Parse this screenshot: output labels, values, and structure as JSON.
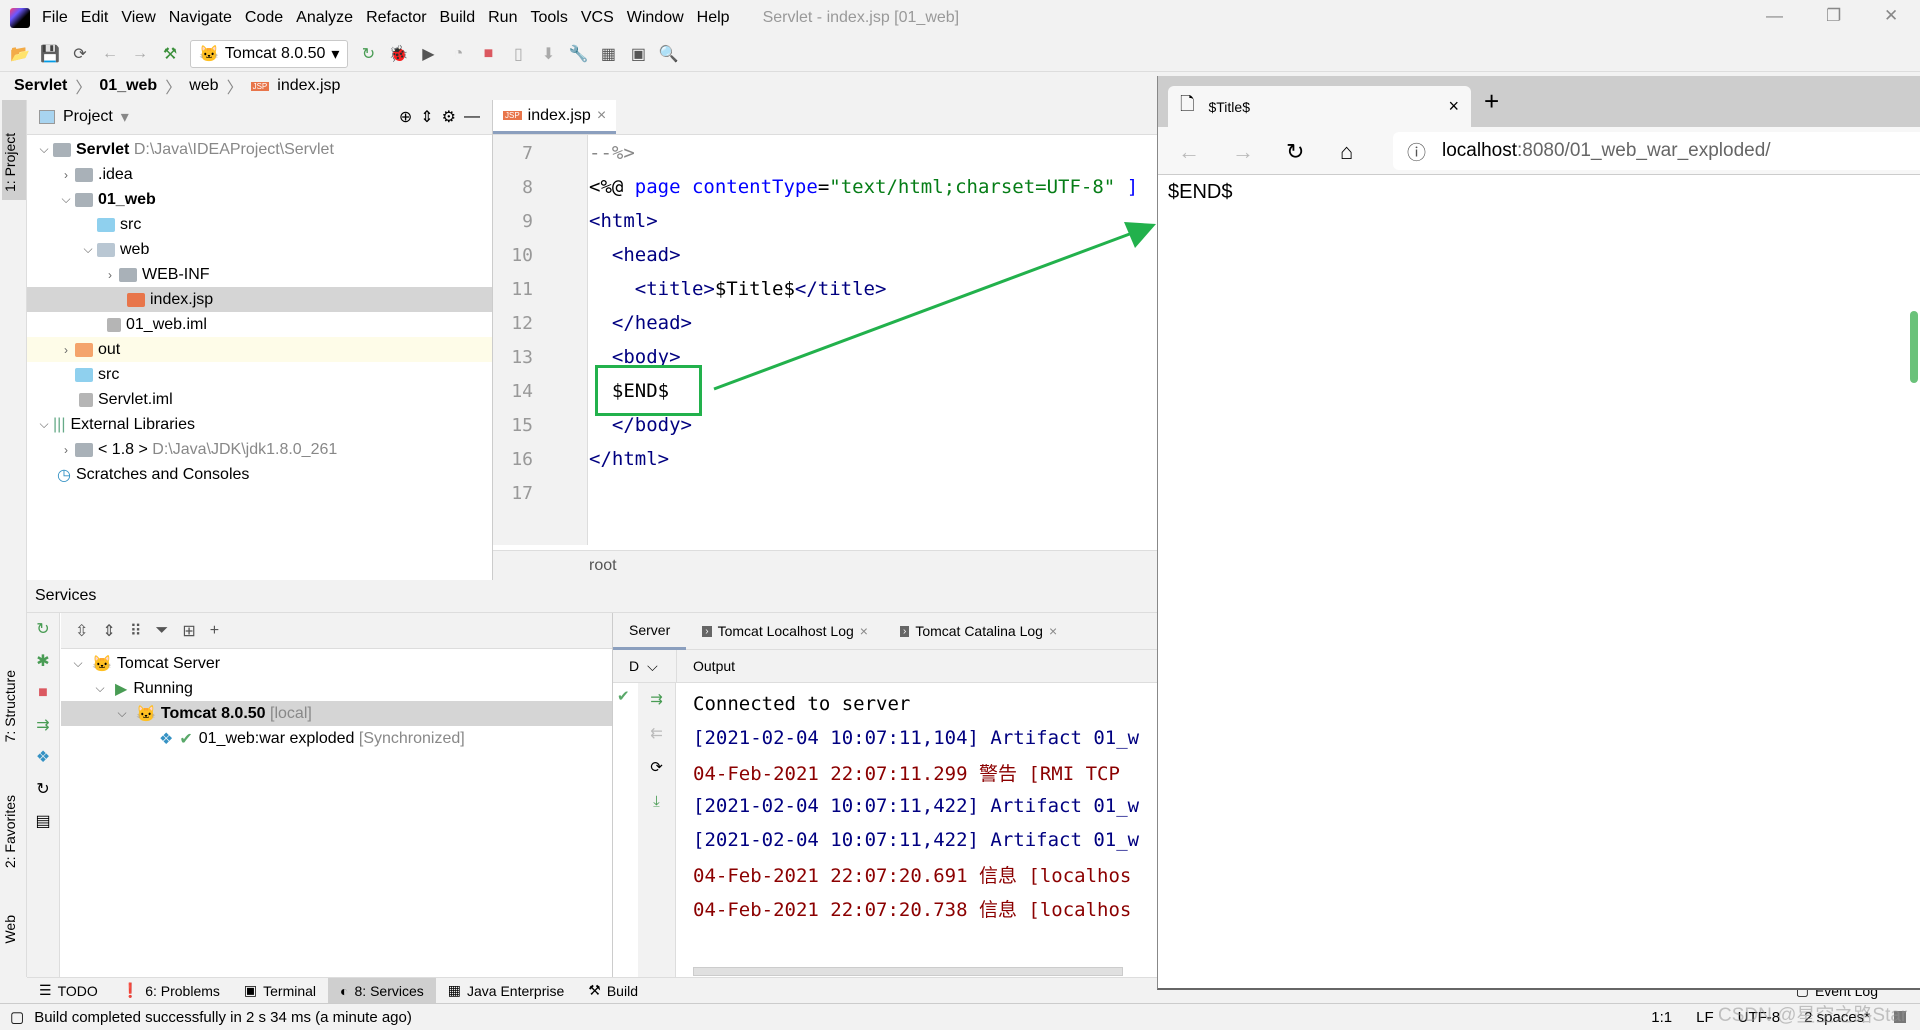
{
  "menubar": {
    "items": [
      "File",
      "Edit",
      "View",
      "Navigate",
      "Code",
      "Analyze",
      "Refactor",
      "Build",
      "Run",
      "Tools",
      "VCS",
      "Window",
      "Help"
    ],
    "title": "Servlet - index.jsp [01_web]"
  },
  "toolbar": {
    "run_config": "Tomcat 8.0.50"
  },
  "breadcrumb": [
    "Servlet",
    "01_web",
    "web",
    "index.jsp"
  ],
  "stripe": {
    "project": "1: Project",
    "structure": "7: Structure",
    "favorites": "2: Favorites",
    "web": "Web"
  },
  "project": {
    "title": "Project",
    "tree": [
      {
        "label": "Servlet",
        "hint": "D:\\Java\\IDEAProject\\Servlet"
      },
      {
        "label": ".idea"
      },
      {
        "label": "01_web"
      },
      {
        "label": "src"
      },
      {
        "label": "web"
      },
      {
        "label": "WEB-INF"
      },
      {
        "label": "index.jsp"
      },
      {
        "label": "01_web.iml"
      },
      {
        "label": "out"
      },
      {
        "label": "src"
      },
      {
        "label": "Servlet.iml"
      },
      {
        "label": "External Libraries"
      },
      {
        "label": "< 1.8 >",
        "hint": "D:\\Java\\JDK\\jdk1.8.0_261"
      },
      {
        "label": "Scratches and Consoles"
      }
    ]
  },
  "editor": {
    "tab": "index.jsp",
    "footer": "root",
    "lines": [
      {
        "n": "7",
        "parts": [
          [
            "--%>",
            "gray"
          ]
        ]
      },
      {
        "n": "8",
        "parts": [
          [
            "<%@ ",
            ""
          ],
          [
            "page ",
            "attr"
          ],
          [
            "contentType",
            "attr"
          ],
          [
            "=",
            ""
          ],
          [
            "\"text/html;charset=UTF-8\"",
            "str"
          ],
          [
            " ]",
            "attr"
          ]
        ]
      },
      {
        "n": "9",
        "parts": [
          [
            "<html>",
            "tag"
          ]
        ]
      },
      {
        "n": "10",
        "parts": [
          [
            "  <head>",
            "tag"
          ]
        ]
      },
      {
        "n": "11",
        "parts": [
          [
            "    <title>",
            "tag"
          ],
          [
            "$Title$",
            ""
          ],
          [
            "</title>",
            "tag"
          ]
        ]
      },
      {
        "n": "12",
        "parts": [
          [
            "  </head>",
            "tag"
          ]
        ]
      },
      {
        "n": "13",
        "parts": [
          [
            "  <body>",
            "tag"
          ]
        ]
      },
      {
        "n": "14",
        "parts": [
          [
            "  $END$",
            ""
          ]
        ]
      },
      {
        "n": "15",
        "parts": [
          [
            "  </body>",
            "tag"
          ]
        ]
      },
      {
        "n": "16",
        "parts": [
          [
            "</html>",
            "tag"
          ]
        ]
      },
      {
        "n": "17",
        "parts": []
      }
    ]
  },
  "services": {
    "title": "Services",
    "tree": [
      {
        "label": "Tomcat Server"
      },
      {
        "label": "Running"
      },
      {
        "label": "Tomcat 8.0.50",
        "hint": "[local]"
      },
      {
        "label": "01_web:war exploded",
        "hint": "[Synchronized]"
      }
    ],
    "tabs": [
      "Server",
      "Tomcat Localhost Log",
      "Tomcat Catalina Log"
    ],
    "deploy_col": "D",
    "output_label": "Output",
    "output": [
      {
        "text": "Connected to server",
        "color": "#000000"
      },
      {
        "text": "[2021-02-04 10:07:11,104] Artifact 01_w",
        "color": "#000080"
      },
      {
        "text": "04-Feb-2021 22:07:11.299 警告 [RMI TCP",
        "color": "#8b0000"
      },
      {
        "text": "[2021-02-04 10:07:11,422] Artifact 01_w",
        "color": "#000080"
      },
      {
        "text": "[2021-02-04 10:07:11,422] Artifact 01_w",
        "color": "#000080"
      },
      {
        "text": "04-Feb-2021 22:07:20.691 信息 [localhos",
        "color": "#8b0000"
      },
      {
        "text": "04-Feb-2021 22:07:20.738 信息 [localhos",
        "color": "#8b0000"
      }
    ]
  },
  "bottomtabs": [
    "TODO",
    "6: Problems",
    "Terminal",
    "8: Services",
    "Java Enterprise",
    "Build"
  ],
  "eventlog": "Event Log",
  "status": {
    "message": "Build completed successfully in 2 s 34 ms (a minute ago)",
    "position": "1:1",
    "line_sep": "LF",
    "encoding": "UTF-8",
    "indent": "2 spaces*"
  },
  "browser": {
    "tab_title": "$Title$",
    "url_host": "localhost",
    "url_rest": ":8080/01_web_war_exploded/",
    "content": "$END$"
  },
  "watermark": "CSDN @星空之路Star",
  "colors": {
    "annotation": "#22b14c",
    "accent": "#8b9fbe"
  }
}
